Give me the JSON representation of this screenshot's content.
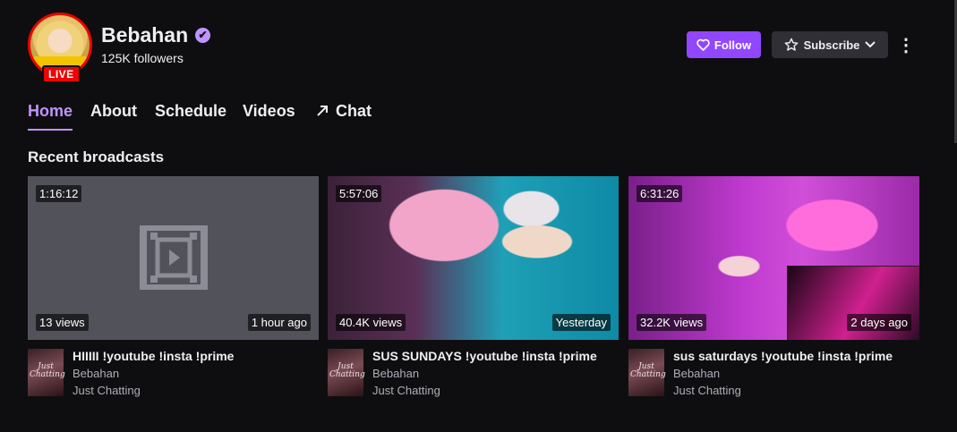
{
  "channel": {
    "name": "Bebahan",
    "followers": "125K followers",
    "live_label": "LIVE",
    "verified_icon": "✔"
  },
  "actions": {
    "follow_label": "Follow",
    "subscribe_label": "Subscribe",
    "more_icon": "⋮"
  },
  "tabs": [
    {
      "label": "Home",
      "active": true
    },
    {
      "label": "About"
    },
    {
      "label": "Schedule"
    },
    {
      "label": "Videos"
    },
    {
      "label": "Chat",
      "icon": "external-arrow-icon"
    }
  ],
  "section": {
    "title": "Recent broadcasts"
  },
  "broadcasts": [
    {
      "duration": "1:16:12",
      "views": "13 views",
      "date": "1 hour ago",
      "title": "HIIIII !youtube !insta !prime",
      "channel": "Bebahan",
      "category": "Just Chatting"
    },
    {
      "duration": "5:57:06",
      "views": "40.4K views",
      "date": "Yesterday",
      "title": "SUS SUNDAYS !youtube !insta !prime",
      "channel": "Bebahan",
      "category": "Just Chatting"
    },
    {
      "duration": "6:31:26",
      "views": "32.2K views",
      "date": "2 days ago",
      "title": "sus saturdays !youtube !insta !prime",
      "channel": "Bebahan",
      "category": "Just Chatting"
    }
  ],
  "category_art_text": "Just Chatting",
  "colors": {
    "accent": "#9147ff",
    "accent_light": "#bf94ff",
    "live": "#eb0400",
    "background": "#0e0e10"
  }
}
